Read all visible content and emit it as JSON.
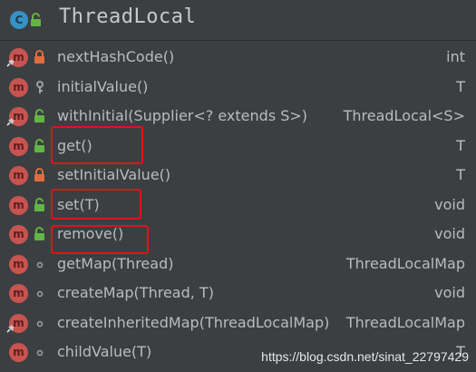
{
  "header": {
    "badge": "C",
    "title": "ThreadLocal"
  },
  "members": [
    {
      "badge": "m",
      "name": "nextHashCode()",
      "type": "int",
      "visibility": "private",
      "static": true
    },
    {
      "badge": "m",
      "name": "initialValue()",
      "type": "T",
      "visibility": "protected",
      "static": false
    },
    {
      "badge": "m",
      "name": "withInitial(Supplier<? extends S>)",
      "type": "ThreadLocal<S>",
      "visibility": "public",
      "static": true
    },
    {
      "badge": "m",
      "name": "get()",
      "type": "T",
      "visibility": "public",
      "static": false
    },
    {
      "badge": "m",
      "name": "setInitialValue()",
      "type": "T",
      "visibility": "private",
      "static": false
    },
    {
      "badge": "m",
      "name": "set(T)",
      "type": "void",
      "visibility": "public",
      "static": false
    },
    {
      "badge": "m",
      "name": "remove()",
      "type": "void",
      "visibility": "public",
      "static": false
    },
    {
      "badge": "m",
      "name": "getMap(Thread)",
      "type": "ThreadLocalMap",
      "visibility": "package",
      "static": false
    },
    {
      "badge": "m",
      "name": "createMap(Thread, T)",
      "type": "void",
      "visibility": "package",
      "static": false
    },
    {
      "badge": "m",
      "name": "createInheritedMap(ThreadLocalMap)",
      "type": "ThreadLocalMap",
      "visibility": "package",
      "static": true
    },
    {
      "badge": "m",
      "name": "childValue(T)",
      "type": "T",
      "visibility": "package",
      "static": false
    }
  ],
  "watermark": "https://blog.csdn.net/sinat_22797429",
  "colors": {
    "background": "#3c3f41",
    "class_badge": "#3592c4",
    "method_badge": "#c75450",
    "highlight": "#e0131a"
  }
}
